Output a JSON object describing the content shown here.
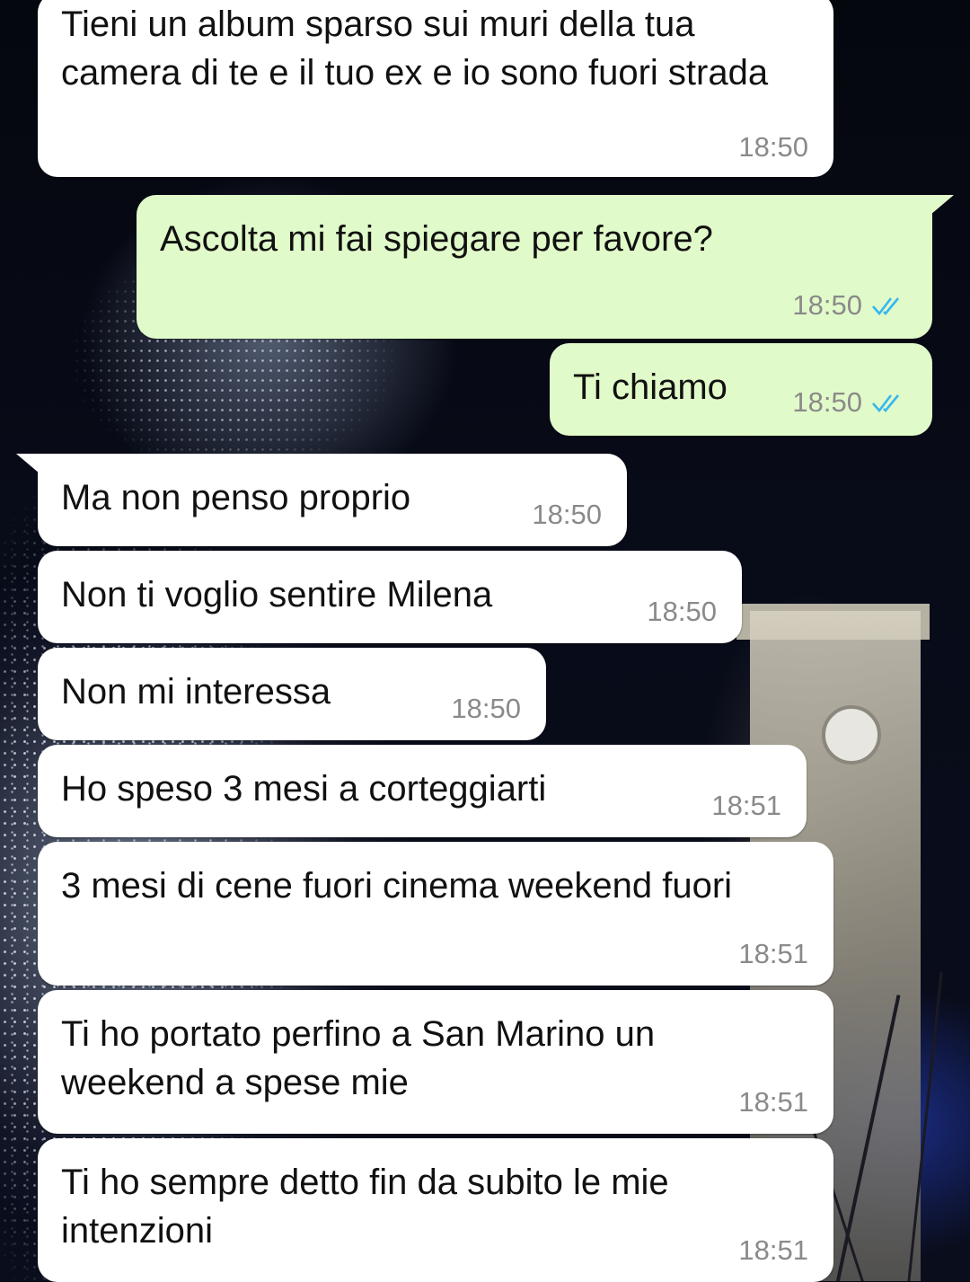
{
  "messages": [
    {
      "direction": "incoming",
      "text": "Tieni un album sparso sui muri della tua camera di te e il tuo ex e io sono fuori strada",
      "time": "18:50"
    },
    {
      "direction": "outgoing",
      "text": "Ascolta mi fai spiegare per favore?",
      "time": "18:50",
      "status": "read"
    },
    {
      "direction": "outgoing",
      "text": "Ti chiamo",
      "time": "18:50",
      "status": "read"
    },
    {
      "direction": "incoming",
      "text": "Ma non penso proprio",
      "time": "18:50"
    },
    {
      "direction": "incoming",
      "text": "Non ti voglio sentire Milena",
      "time": "18:50"
    },
    {
      "direction": "incoming",
      "text": "Non mi interessa",
      "time": "18:50"
    },
    {
      "direction": "incoming",
      "text": "Ho speso 3 mesi a corteggiarti",
      "time": "18:51"
    },
    {
      "direction": "incoming",
      "text": "3 mesi di cene fuori cinema weekend fuori",
      "time": "18:51"
    },
    {
      "direction": "incoming",
      "text": "Ti ho portato perfino a San Marino un weekend a spese mie",
      "time": "18:51"
    },
    {
      "direction": "incoming",
      "text": "Ti ho sempre detto fin da subito le mie intenzioni",
      "time": "18:51"
    }
  ],
  "colors": {
    "incoming_bubble": "#ffffff",
    "outgoing_bubble": "#e1fac9",
    "timestamp": "#8a8a8a",
    "read_tick": "#34b7f1"
  },
  "icons": {
    "read_receipt": "double-check-icon"
  }
}
